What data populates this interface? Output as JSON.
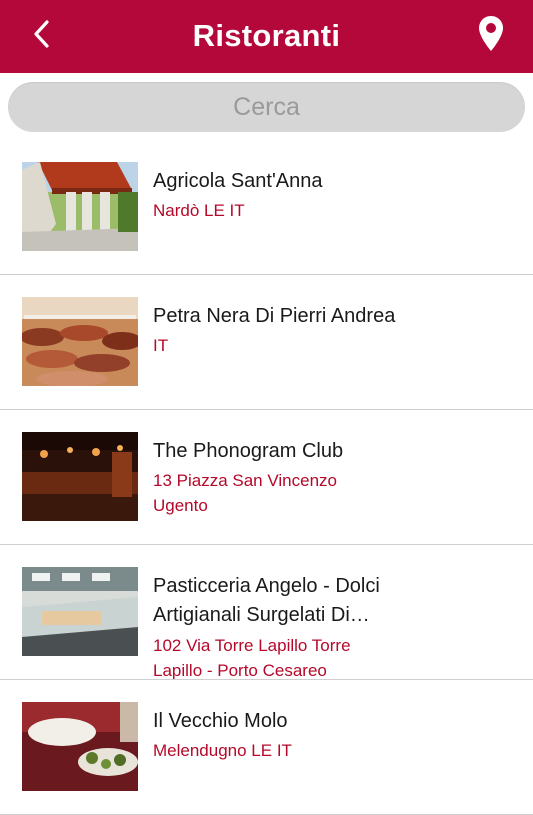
{
  "header": {
    "title": "Ristoranti",
    "accent": "#b5083a",
    "back_icon": "chevron-left-icon",
    "map_icon": "map-pin-icon"
  },
  "search": {
    "placeholder": "Cerca"
  },
  "restaurants": [
    {
      "name": "Agricola Sant'Anna",
      "address_lines": [
        "Nardò LE IT"
      ],
      "image": "stone-gate-photo"
    },
    {
      "name": "Petra Nera Di Pierri Andrea",
      "address_lines": [
        "IT"
      ],
      "image": "grilled-meat-photo"
    },
    {
      "name": "The Phonogram Club",
      "address_lines": [
        "13 Piazza San Vincenzo",
        "Ugento"
      ],
      "image": "dark-bar-photo"
    },
    {
      "name_lines": [
        "Pasticceria Angelo - Dolci",
        "Artigianali Surgelati Di…"
      ],
      "address_lines": [
        "102 Via Torre Lapillo Torre",
        "Lapillo - Porto Cesareo"
      ],
      "image": "pastry-counter-photo"
    },
    {
      "name": "Il Vecchio Molo",
      "address_lines": [
        "Melendugno LE IT"
      ],
      "image": "table-food-photo"
    }
  ],
  "colors": {
    "address_text": "#b5082a",
    "search_bg": "#d6d6d6"
  }
}
